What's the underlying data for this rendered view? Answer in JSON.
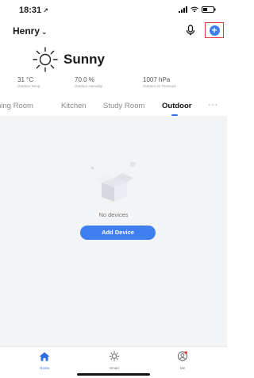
{
  "status": {
    "time": "18:31",
    "location_glyph": "↗"
  },
  "header": {
    "home_name": "Henry",
    "chevron": "⌄"
  },
  "weather": {
    "condition": "Sunny"
  },
  "stats": [
    {
      "value": "31 °C",
      "label": "Outdoor Temp"
    },
    {
      "value": "70.0 %",
      "label": "Outdoor Humidity"
    },
    {
      "value": "1007 hPa",
      "label": "Outdoor Air Pressure"
    }
  ],
  "tabs": [
    {
      "label": "Dining Room",
      "active": false
    },
    {
      "label": "Kitchen",
      "active": false
    },
    {
      "label": "Study Room",
      "active": false
    },
    {
      "label": "Outdoor",
      "active": true
    }
  ],
  "more_tabs": "···",
  "empty_state": {
    "message": "No devices",
    "button_label": "Add Device"
  },
  "tabbar": [
    {
      "label": "Home",
      "icon": "home-icon",
      "active": true
    },
    {
      "label": "Smart",
      "icon": "sun-icon",
      "active": false
    },
    {
      "label": "Me",
      "icon": "user-icon",
      "active": false
    }
  ],
  "colors": {
    "accent": "#3f7ff0",
    "highlight_box": "#e23b3b",
    "content_bg": "#f3f4f6"
  }
}
